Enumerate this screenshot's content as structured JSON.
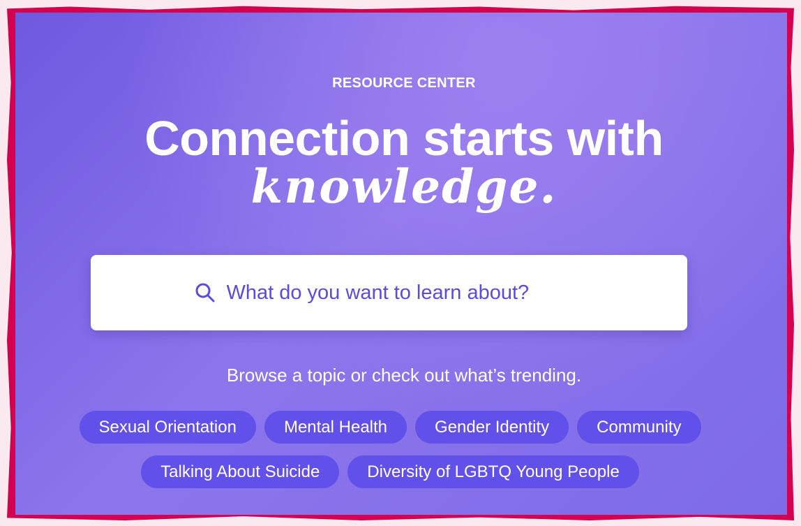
{
  "header": {
    "eyebrow": "RESOURCE CENTER",
    "headline": "Connection starts with",
    "headline_script": "knowledge."
  },
  "search": {
    "placeholder": "What do you want to learn about?",
    "icon": "search-icon"
  },
  "browse_text": "Browse a topic or check out what’s trending.",
  "topics": {
    "row1": [
      "Sexual Orientation",
      "Mental Health",
      "Gender Identity",
      "Community"
    ],
    "row2": [
      "Talking About Suicide",
      "Diversity of LGBTQ Young People"
    ]
  },
  "colors": {
    "frame": "#d4004f",
    "background": "#7e6be8",
    "tag": "#6250ea",
    "search_text": "#5a4be0"
  }
}
